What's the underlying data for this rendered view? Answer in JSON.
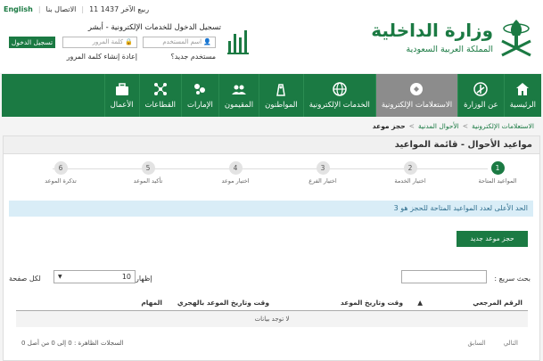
{
  "utility": {
    "date": "11 ربيع الآخر 1437",
    "contact": "الاتصال بنا",
    "language": "English"
  },
  "login": {
    "title": "تسجيل الدخول للخدمات الإلكترونية - أبشر",
    "username_placeholder": "اسم المستخدم",
    "password_placeholder": "كلمة المرور",
    "login_button": "تسجيل الدخول",
    "new_user": "مستخدم جديد؟",
    "reset_password": "إعادة إنشاء كلمة المرور"
  },
  "ministry": {
    "title": "وزارة الداخلية",
    "subtitle": "المملكة العربية السعودية"
  },
  "nav": {
    "items": [
      {
        "label": "الرئيسية",
        "icon": "home-icon"
      },
      {
        "label": "عن الوزارة",
        "icon": "ministry-emblem-icon"
      },
      {
        "label": "الاستعلامات الإلكترونية",
        "icon": "inquiry-icon",
        "active": true
      },
      {
        "label": "الخدمات الإلكترونية",
        "icon": "globe-icon"
      },
      {
        "label": "المواطنون",
        "icon": "citizen-icon"
      },
      {
        "label": "المقيمون",
        "icon": "residents-icon"
      },
      {
        "label": "الإمارات",
        "icon": "emirates-icon"
      },
      {
        "label": "القطاعات",
        "icon": "sectors-icon"
      },
      {
        "label": "الأعمال",
        "icon": "briefcase-icon"
      }
    ]
  },
  "breadcrumb": {
    "items": [
      "الاستعلامات الإلكترونية",
      "الأحوال المدنية",
      "حجز موعد"
    ]
  },
  "panel": {
    "title": "مواعيد الأحوال - قائمة المواعيد",
    "steps": [
      {
        "num": "1",
        "label": "المواعيد المتاحة"
      },
      {
        "num": "2",
        "label": "اختيار الخدمة"
      },
      {
        "num": "3",
        "label": "اختيار الفرع"
      },
      {
        "num": "4",
        "label": "اختيار موعد"
      },
      {
        "num": "5",
        "label": "تأكيد الموعد"
      },
      {
        "num": "6",
        "label": "تذكرة الموعد"
      }
    ],
    "alert": "الحد الأعلى لعدد المواعيد المتاحة للحجز هو 3",
    "new_booking": "حجز موعد جديد"
  },
  "table": {
    "search_label": "بحث سريع :",
    "show_label": "إظهار",
    "per_page_value": "10",
    "per_page_label": "لكل صفحة",
    "columns": [
      "الرقم المرجعي",
      "وقت وتاريخ الموعد",
      "وقت وتاريخ الموعد بالهجري",
      "المهام"
    ],
    "empty_text": "لا توجد بيانات",
    "records_info": "السجلات الظاهرة : 0 إلى 0 من أصل 0",
    "pager": {
      "previous": "السابق",
      "next": "التالي"
    }
  },
  "colors": {
    "brand_green": "#1b7a43",
    "active_nav": "#8c8c8c",
    "alert_bg": "#d9edf7"
  }
}
